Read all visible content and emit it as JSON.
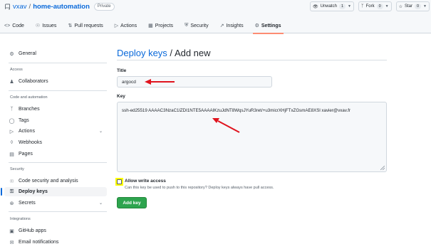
{
  "header": {
    "owner": "vxav",
    "separator": "/",
    "repo": "home-automation",
    "visibility": "Private",
    "unwatch_label": "Unwatch",
    "unwatch_count": "1",
    "fork_label": "Fork",
    "fork_count": "0",
    "star_label": "Star",
    "star_count": "0"
  },
  "tabs": [
    {
      "label": "Code",
      "icon": "code-icon"
    },
    {
      "label": "Issues",
      "icon": "issue-icon"
    },
    {
      "label": "Pull requests",
      "icon": "pull-request-icon"
    },
    {
      "label": "Actions",
      "icon": "play-icon"
    },
    {
      "label": "Projects",
      "icon": "table-icon"
    },
    {
      "label": "Security",
      "icon": "shield-icon"
    },
    {
      "label": "Insights",
      "icon": "graph-icon"
    },
    {
      "label": "Settings",
      "icon": "gear-icon",
      "active": true
    }
  ],
  "sidebar": {
    "general": "General",
    "access_heading": "Access",
    "collaborators": "Collaborators",
    "code_heading": "Code and automation",
    "branches": "Branches",
    "tags": "Tags",
    "actions": "Actions",
    "webhooks": "Webhooks",
    "pages": "Pages",
    "security_heading": "Security",
    "code_security": "Code security and analysis",
    "deploy_keys": "Deploy keys",
    "secrets": "Secrets",
    "integrations_heading": "Integrations",
    "github_apps": "GitHub apps",
    "email_notifications": "Email notifications"
  },
  "main": {
    "breadcrumb_link": "Deploy keys",
    "breadcrumb_sep": " / ",
    "breadcrumb_current": "Add new",
    "title_label": "Title",
    "title_value": "argocd",
    "key_label": "Key",
    "key_value": "ssh-ed25519 AAAAC3NzaC1lZDI1NTE5AAAAIKzuJdNT8WqsJYuR3ret/+u3micrXHjFTxZGsmAE8XSl xavier@vxav.fr",
    "write_access_label": "Allow write access",
    "write_access_help": "Can this key be used to push to this repository? Deploy keys always have pull access.",
    "add_button": "Add key"
  },
  "colors": {
    "accent": "#0969da",
    "annotation_arrow": "#e0141e",
    "highlight": "#ffff00",
    "primary_button": "#2da44e"
  }
}
